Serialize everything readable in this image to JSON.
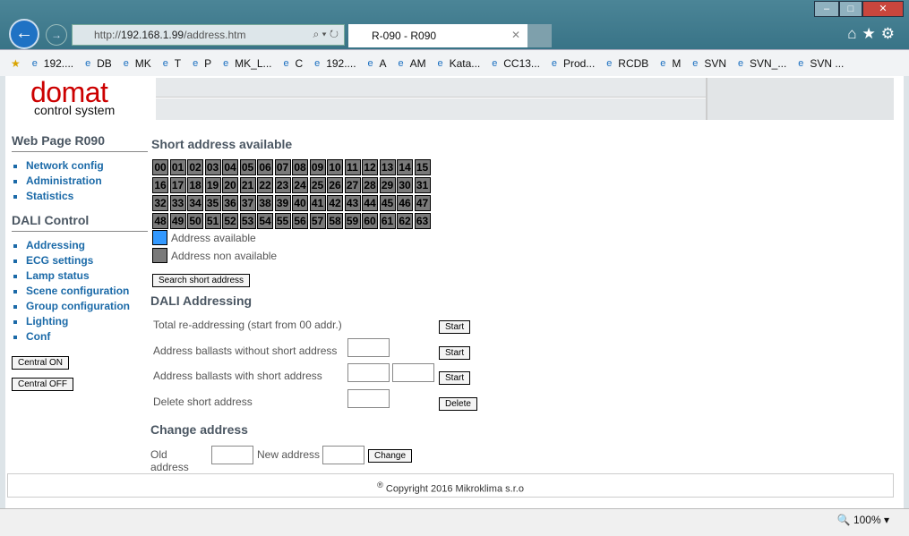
{
  "browser": {
    "url_prefix": "http://",
    "url_host": "192.168.1.99",
    "url_path": "/address.htm",
    "tab_title": "R-090 - R090",
    "zoom": "100%",
    "favorites": [
      "192....",
      "DB",
      "MK",
      "T",
      "P",
      "MK_L...",
      "C",
      "192....",
      "A",
      "AM",
      "Kata...",
      "CC13...",
      "Prod...",
      "RCDB",
      "M",
      "SVN",
      "SVN_...",
      "SVN ..."
    ]
  },
  "logo": {
    "name": "domat",
    "tagline": "control system"
  },
  "sidebar": {
    "title": "Web Page R090",
    "items1": [
      "Network config",
      "Administration",
      "Statistics"
    ],
    "section2": "DALI Control",
    "items2": [
      "Addressing",
      "ECG settings",
      "Lamp status",
      "Scene configuration",
      "Group configuration",
      "Lighting",
      "Conf"
    ],
    "central_on": "Central ON",
    "central_off": "Central OFF"
  },
  "short": {
    "title": "Short address available",
    "addresses": [
      "00",
      "01",
      "02",
      "03",
      "04",
      "05",
      "06",
      "07",
      "08",
      "09",
      "10",
      "11",
      "12",
      "13",
      "14",
      "15",
      "16",
      "17",
      "18",
      "19",
      "20",
      "21",
      "22",
      "23",
      "24",
      "25",
      "26",
      "27",
      "28",
      "29",
      "30",
      "31",
      "32",
      "33",
      "34",
      "35",
      "36",
      "37",
      "38",
      "39",
      "40",
      "41",
      "42",
      "43",
      "44",
      "45",
      "46",
      "47",
      "48",
      "49",
      "50",
      "51",
      "52",
      "53",
      "54",
      "55",
      "56",
      "57",
      "58",
      "59",
      "60",
      "61",
      "62",
      "63"
    ],
    "available_color": "#3399ff",
    "unavailable_color": "#7a7a7a",
    "legend_available": "Address available",
    "legend_unavailable": "Address non available",
    "search_button": "Search short address"
  },
  "dali": {
    "title": "DALI Addressing",
    "rows": [
      {
        "label": "Total re-addressing (start from 00 addr.)",
        "button": "Start"
      },
      {
        "label": "Address ballasts without short address",
        "button": "Start"
      },
      {
        "label": "Address ballasts with short address",
        "button": "Start"
      },
      {
        "label": "Delete short address",
        "button": "Delete"
      }
    ]
  },
  "change": {
    "title": "Change address",
    "old_label": "Old address",
    "new_label": "New address",
    "button": "Change"
  },
  "footer": {
    "copyright": "Copyright 2016 Mikroklima s.r.o",
    "mark": "®"
  }
}
